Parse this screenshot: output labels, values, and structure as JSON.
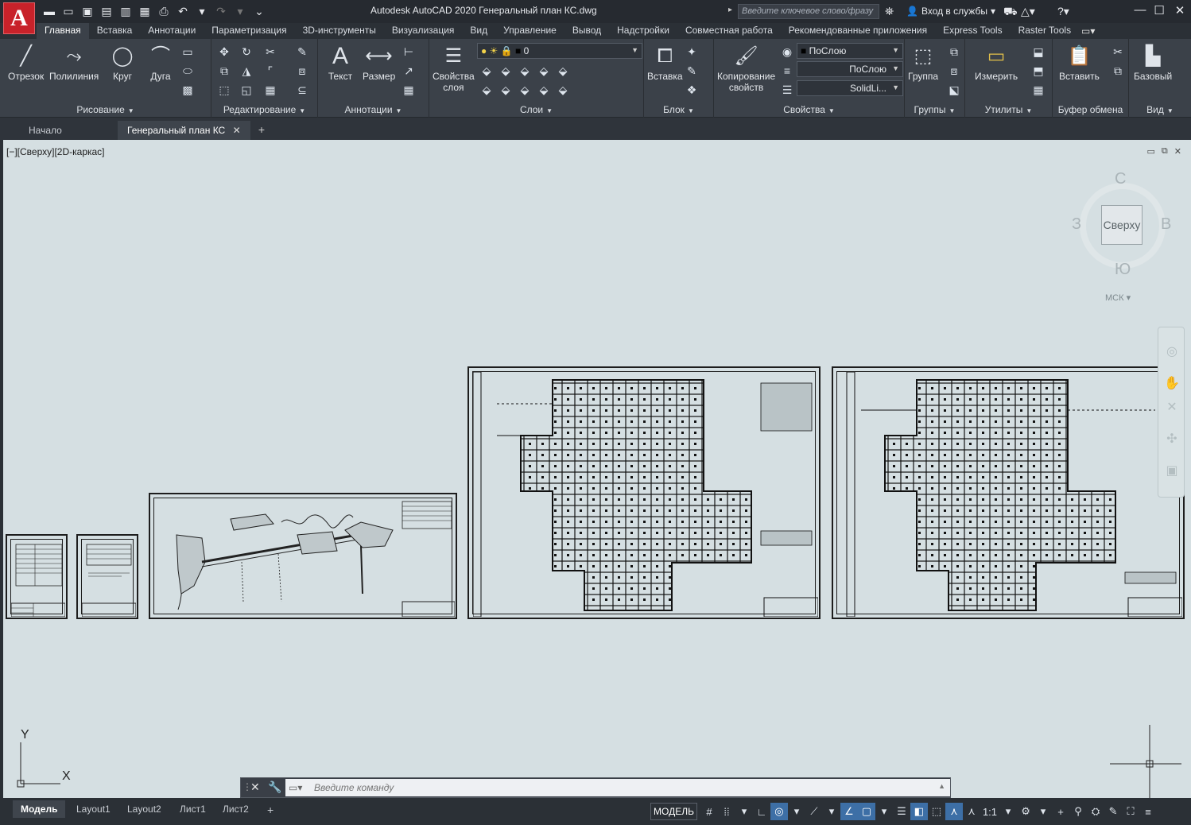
{
  "app": {
    "title": "Autodesk AutoCAD 2020   Генеральный план КС.dwg",
    "logo_letter": "A",
    "search_placeholder": "Введите ключевое слово/фразу",
    "signin_label": "Вход в службы"
  },
  "ribbon_tabs": [
    {
      "label": "Главная",
      "active": true
    },
    {
      "label": "Вставка"
    },
    {
      "label": "Аннотации"
    },
    {
      "label": "Параметризация"
    },
    {
      "label": "3D-инструменты"
    },
    {
      "label": "Визуализация"
    },
    {
      "label": "Вид"
    },
    {
      "label": "Управление"
    },
    {
      "label": "Вывод"
    },
    {
      "label": "Надстройки"
    },
    {
      "label": "Совместная работа"
    },
    {
      "label": "Рекомендованные приложения"
    },
    {
      "label": "Express Tools"
    },
    {
      "label": "Raster Tools"
    }
  ],
  "panels": {
    "draw": {
      "title": "Рисование",
      "tools": [
        "Отрезок",
        "Полилиния",
        "Круг",
        "Дуга"
      ]
    },
    "modify": {
      "title": "Редактирование"
    },
    "annotation": {
      "title": "Аннотации",
      "tools": [
        "Текст",
        "Размер"
      ]
    },
    "layers": {
      "title": "Слои",
      "props_line1": "Свойства",
      "props_line2": "слоя",
      "current_layer": "0"
    },
    "block": {
      "title": "Блок",
      "insert": "Вставка"
    },
    "properties": {
      "title": "Свойства",
      "match_line1": "Копирование",
      "match_line2": "свойств",
      "color": "ПоСлою",
      "lineweight": "ПоСлою",
      "linetype": "SolidLi..."
    },
    "groups": {
      "title": "Группы",
      "group": "Группа"
    },
    "utilities": {
      "title": "Утилиты",
      "measure": "Измерить"
    },
    "clipboard": {
      "title": "Буфер обмена",
      "paste": "Вставить"
    },
    "view": {
      "title": "Вид",
      "base": "Базовый"
    }
  },
  "doc_tabs": {
    "start": "Начало",
    "current": "Генеральный план КС"
  },
  "viewport": {
    "label": "[−][Сверху][2D-каркас]",
    "viewcube": {
      "face": "Сверху",
      "north": "С",
      "south": "Ю",
      "west": "З",
      "east": "В",
      "wcs": "МСК"
    },
    "ucs": {
      "x": "X",
      "y": "Y"
    }
  },
  "command_line": {
    "placeholder": "Введите команду"
  },
  "layout_tabs": [
    "Модель",
    "Layout1",
    "Layout2",
    "Лист1",
    "Лист2"
  ],
  "status": {
    "model_label": "МОДЕЛЬ",
    "scale": "1:1"
  }
}
